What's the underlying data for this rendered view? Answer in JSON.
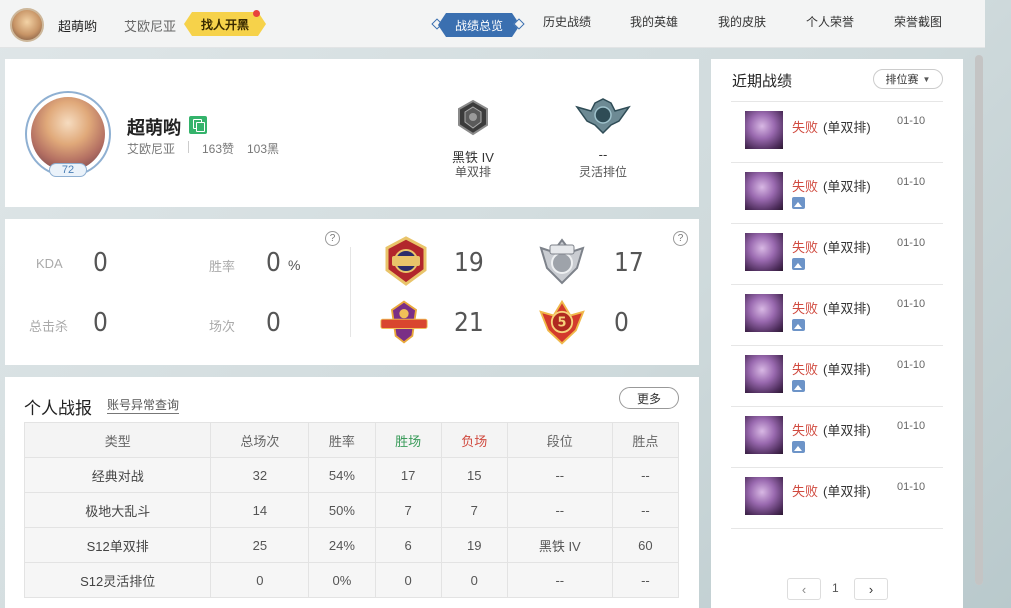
{
  "header": {
    "nickname": "超萌哟",
    "server": "艾欧尼亚",
    "find_button": "找人开黑",
    "nav": [
      "战绩总览",
      "历史战绩",
      "我的英雄",
      "我的皮肤",
      "个人荣誉",
      "荣誉截图"
    ],
    "active_nav": "战绩总览"
  },
  "profile": {
    "nickname": "超萌哟",
    "server": "艾欧尼亚",
    "likes": "163赞",
    "blacks": "103黑",
    "level": "72",
    "ranks": [
      {
        "name": "黑铁 IV",
        "queue": "单双排"
      },
      {
        "name": "--",
        "queue": "灵活排位"
      }
    ]
  },
  "stats": {
    "kda_label": "KDA",
    "kda": "0",
    "winrate_label": "胜率",
    "winrate": "0",
    "winrate_unit": "%",
    "kills_label": "总击杀",
    "kills": "0",
    "games_label": "场次",
    "games": "0",
    "help": "?",
    "honors": [
      {
        "icon": "mvp-icon",
        "value": "19"
      },
      {
        "icon": "svp-icon",
        "value": "17"
      },
      {
        "icon": "legendary-icon",
        "value": "21"
      },
      {
        "icon": "pentakill-icon",
        "value": "0"
      }
    ]
  },
  "report": {
    "title": "个人战报",
    "link": "账号异常查询",
    "more": "更多",
    "headers": [
      "类型",
      "总场次",
      "胜率",
      "胜场",
      "负场",
      "段位",
      "胜点"
    ],
    "rows": [
      [
        "经典对战",
        "32",
        "54%",
        "17",
        "15",
        "--",
        "--"
      ],
      [
        "极地大乱斗",
        "14",
        "50%",
        "7",
        "7",
        "--",
        "--"
      ],
      [
        "S12单双排",
        "25",
        "24%",
        "6",
        "19",
        "黑铁 IV",
        "60"
      ],
      [
        "S12灵活排位",
        "0",
        "0%",
        "0",
        "0",
        "--",
        "--"
      ]
    ]
  },
  "recent": {
    "title": "近期战绩",
    "filter": "排位赛",
    "matches": [
      {
        "result": "失败",
        "queue": "(单双排)",
        "date": "01-10",
        "has_image": false
      },
      {
        "result": "失败",
        "queue": "(单双排)",
        "date": "01-10",
        "has_image": true
      },
      {
        "result": "失败",
        "queue": "(单双排)",
        "date": "01-10",
        "has_image": true
      },
      {
        "result": "失败",
        "queue": "(单双排)",
        "date": "01-10",
        "has_image": true
      },
      {
        "result": "失败",
        "queue": "(单双排)",
        "date": "01-10",
        "has_image": true
      },
      {
        "result": "失败",
        "queue": "(单双排)",
        "date": "01-10",
        "has_image": true
      },
      {
        "result": "失败",
        "queue": "(单双排)",
        "date": "01-10",
        "has_image": false
      }
    ],
    "page": "1",
    "prev": "‹",
    "next": "›"
  },
  "colors": {
    "accent": "#3a6fb0",
    "find_button": "#f6d24a",
    "win": "#3a9b5a",
    "lose": "#d04a3f"
  }
}
